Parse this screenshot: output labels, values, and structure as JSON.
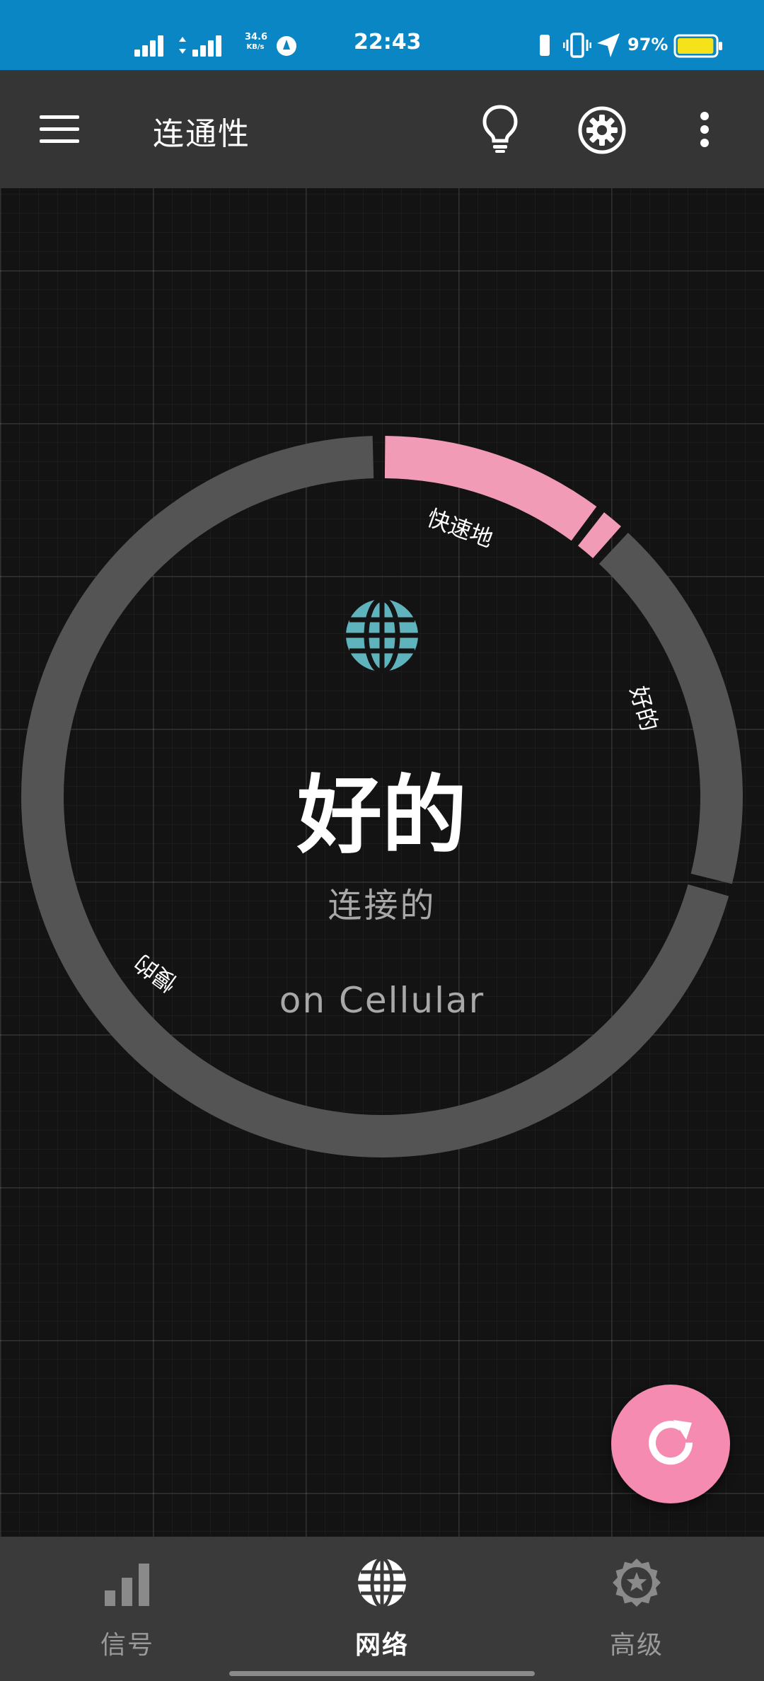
{
  "status_bar": {
    "net_speed_value": "34.6",
    "net_speed_unit": "KB/s",
    "time": "22:43",
    "battery_percent": "97%",
    "battery_level": 0.97,
    "battery_color": "#f5e21a"
  },
  "app_bar": {
    "title": "连通性",
    "icons": [
      "menu-icon",
      "lightbulb-icon",
      "gear-icon",
      "more-vert-icon"
    ]
  },
  "gauge": {
    "quality": "好的",
    "status": "连接的",
    "network": "on Cellular",
    "segments": [
      {
        "label": "快速地",
        "level": "fast",
        "active": true
      },
      {
        "label": "好的",
        "level": "good",
        "active": false
      },
      {
        "label": "慢的",
        "level": "slow",
        "active": false
      }
    ],
    "active_color": "#f29bb7",
    "inactive_color": "#545454",
    "globe_color": "#5fb3bd",
    "icon": "globe-icon"
  },
  "fab": {
    "icon": "refresh-icon",
    "color": "#f58bb0"
  },
  "bottom_nav": {
    "items": [
      {
        "label": "信号",
        "icon": "signal-bars-icon",
        "active": false
      },
      {
        "label": "网络",
        "icon": "globe-icon",
        "active": true
      },
      {
        "label": "高级",
        "icon": "star-badge-icon",
        "active": false
      }
    ]
  }
}
